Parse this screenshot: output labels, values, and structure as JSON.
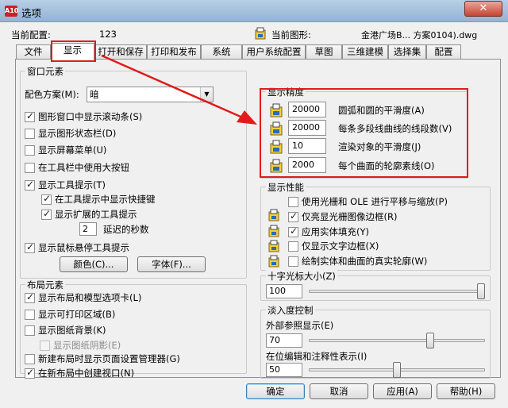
{
  "window": {
    "title": "选项",
    "app_icon_text": "A10",
    "close_glyph": "✕"
  },
  "header": {
    "config_label": "当前配置:",
    "config_value": "123",
    "drawing_label": "当前图形:",
    "drawing_value": "金港广场B... 方案0104).dwg"
  },
  "tabs": [
    {
      "label": "文件"
    },
    {
      "label": "显示",
      "active": true
    },
    {
      "label": "打开和保存"
    },
    {
      "label": "打印和发布"
    },
    {
      "label": "系统"
    },
    {
      "label": "用户系统配置"
    },
    {
      "label": "草图"
    },
    {
      "label": "三维建模"
    },
    {
      "label": "选择集"
    },
    {
      "label": "配置"
    }
  ],
  "window_elements": {
    "title": "窗口元素",
    "color_scheme_label": "配色方案(M):",
    "color_scheme_value": "暗",
    "checkboxes": [
      {
        "label": "图形窗口中显示滚动条(S)",
        "checked": true,
        "disabled": false
      },
      {
        "label": "显示图形状态栏(D)",
        "checked": false,
        "disabled": false
      },
      {
        "label": "显示屏幕菜单(U)",
        "checked": false,
        "disabled": false
      },
      {
        "label": "在工具栏中使用大按钮",
        "checked": false,
        "disabled": false
      },
      {
        "label": "显示工具提示(T)",
        "checked": true,
        "disabled": false
      },
      {
        "label": "在工具提示中显示快捷键",
        "checked": true,
        "disabled": false
      },
      {
        "label": "显示扩展的工具提示",
        "checked": true,
        "disabled": false
      },
      {
        "label": "显示鼠标悬停工具提示",
        "checked": true,
        "disabled": false
      }
    ],
    "delay_value": "2",
    "delay_label": "延迟的秒数",
    "colors_button": "颜色(C)...",
    "fonts_button": "字体(F)..."
  },
  "layout_elements": {
    "title": "布局元素",
    "checkboxes": [
      {
        "label": "显示布局和模型选项卡(L)",
        "checked": true,
        "disabled": false
      },
      {
        "label": "显示可打印区域(B)",
        "checked": false,
        "disabled": false
      },
      {
        "label": "显示图纸背景(K)",
        "checked": false,
        "disabled": false
      },
      {
        "label": "显示图纸阴影(E)",
        "checked": false,
        "disabled": true
      },
      {
        "label": "新建布局时显示页面设置管理器(G)",
        "checked": false,
        "disabled": false
      },
      {
        "label": "在新布局中创建视口(N)",
        "checked": true,
        "disabled": false
      }
    ]
  },
  "display_resolution": {
    "title": "显示精度",
    "items": [
      {
        "value": "20000",
        "label": "圆弧和圆的平滑度(A)"
      },
      {
        "value": "20000",
        "label": "每条多段线曲线的线段数(V)"
      },
      {
        "value": "10",
        "label": "渲染对象的平滑度(J)"
      },
      {
        "value": "2000",
        "label": "每个曲面的轮廓素线(O)"
      }
    ]
  },
  "display_performance": {
    "title": "显示性能",
    "items": [
      {
        "label": "使用光栅和 OLE 进行平移与缩放(P)",
        "checked": false
      },
      {
        "label": "仅亮显光栅图像边框(R)",
        "checked": true
      },
      {
        "label": "应用实体填充(Y)",
        "checked": true
      },
      {
        "label": "仅显示文字边框(X)",
        "checked": false
      },
      {
        "label": "绘制实体和曲面的真实轮廓(W)",
        "checked": false
      }
    ]
  },
  "crosshair": {
    "title": "十字光标大小(Z)",
    "value": "100",
    "level_fraction": 1.0
  },
  "fade_control": {
    "title": "淡入度控制",
    "xref_label": "外部参照显示(E)",
    "xref_value": "70",
    "xref_fraction": 0.7,
    "inplace_label": "在位编辑和注释性表示(I)",
    "inplace_value": "50",
    "inplace_fraction": 0.5
  },
  "buttons": {
    "ok": "确定",
    "cancel": "取消",
    "apply": "应用(A)",
    "help": "帮助(H)"
  },
  "colors": {
    "annotation_red": "#e31b1b",
    "title_bar": "#9fbad9"
  }
}
